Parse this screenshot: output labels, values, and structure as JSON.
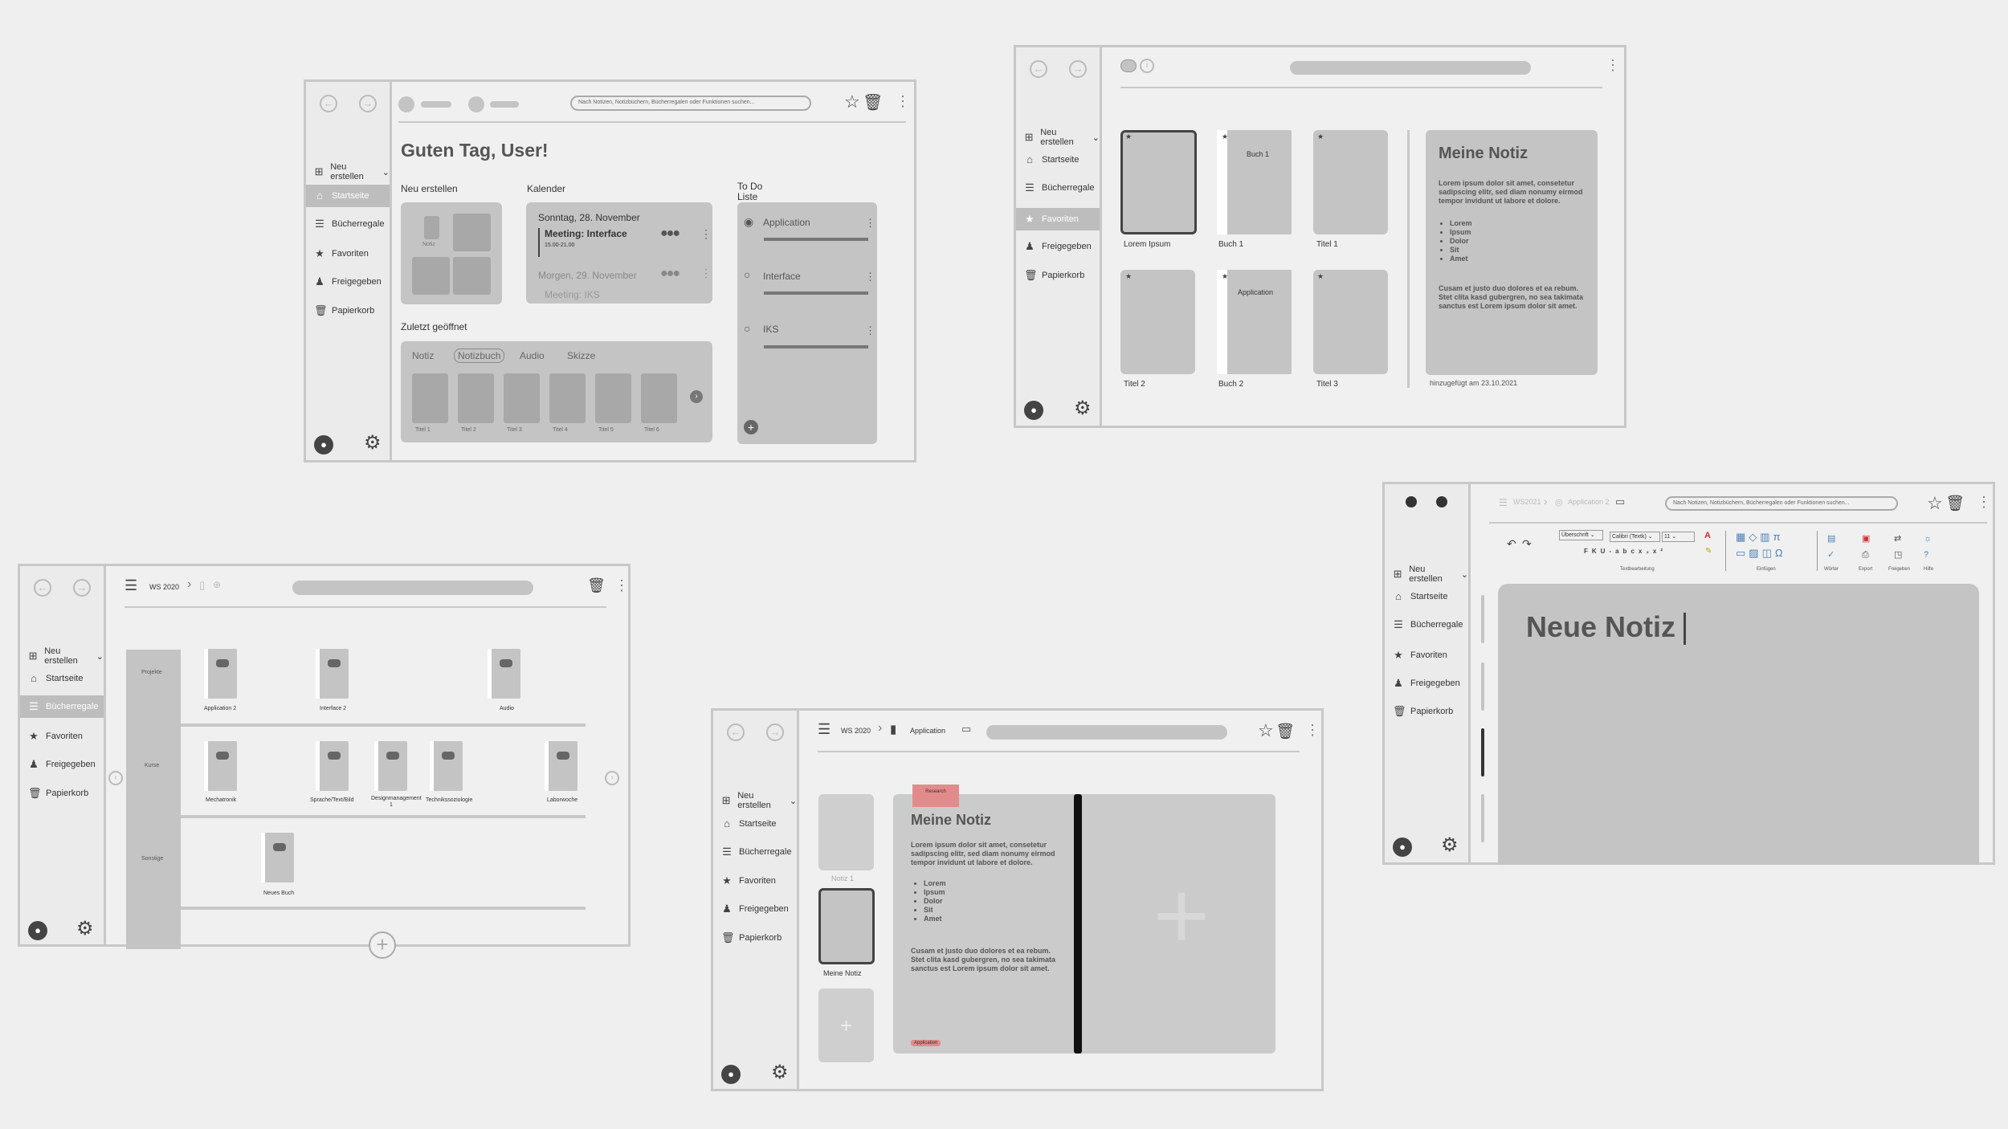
{
  "nav": {
    "neu": "Neu erstellen",
    "start": "Startseite",
    "buecher": "Bücherregale",
    "fav": "Favoriten",
    "frei": "Freigegeben",
    "papier": "Papierkorb"
  },
  "icons": {
    "back": "arrow-left-icon",
    "forward": "arrow-right-icon",
    "plus": "plus-square-icon",
    "home": "home-icon",
    "shelf": "bookshelf-icon",
    "star": "star-icon",
    "shared": "users-icon",
    "trash": "trash-icon",
    "user": "user-icon",
    "settings": "gear-icon"
  },
  "screen1": {
    "search_placeholder": "Nach Notizen, Notizbüchern, Bücherregalen oder Funktionen suchen...",
    "greeting": "Guten Tag, User!",
    "neu_title": "Neu erstellen",
    "notiz": "Notiz",
    "kalender": "Kalender",
    "cal_date1": "Sonntag, 28. November",
    "cal_event1": "Meeting: Interface",
    "cal_time1": "15.00-21.00",
    "cal_date2": "Morgen, 29. November",
    "cal_event2": "Meeting: IKS",
    "todo_title": "To Do",
    "todo_title2": "Liste",
    "todos": [
      "Application",
      "Interface",
      "IKS"
    ],
    "zuletzt": "Zuletzt geöffnet",
    "tabs": [
      "Notiz",
      "Notizbuch",
      "Audio",
      "Skizze"
    ],
    "titles": [
      "Titel 1",
      "Titel 2",
      "Titel 3",
      "Titel 4",
      "Titel 5",
      "Titel 6"
    ]
  },
  "screen2": {
    "cards": [
      "Lorem Ipsum",
      "Buch 1",
      "Titel 1",
      "Titel 2",
      "Buch 2",
      "Titel 3"
    ],
    "book1_label": "Buch 1",
    "book2_label": "Application",
    "preview_title": "Meine Notiz",
    "preview_p1": "Lorem ipsum dolor sit amet, consetetur sadipscing elitr, sed diam nonumy eirmod tempor invidunt ut labore et dolore.",
    "preview_list": [
      "Lorem",
      "Ipsum",
      "Dolor",
      "Sit",
      "Amet"
    ],
    "preview_p2": "Cusam et justo duo dolores et ea rebum. Stet clita kasd gubergren, no sea takimata sanctus est Lorem ipsum dolor sit amet.",
    "added": "hinzugefügt am 23.10.2021"
  },
  "screen3": {
    "crumb": "WS 2020",
    "rows": [
      "Projekte",
      "Kurse",
      "Sonstige"
    ],
    "books_r1": [
      "Application 2",
      "Interface 2",
      "Audio"
    ],
    "books_r2": [
      "Mechatronik",
      "Sprache/Text/Bild",
      "Designmanagement 1",
      "Technikssoziologie",
      "Laborwoche"
    ],
    "books_r3": [
      "Neues Buch"
    ]
  },
  "screen4": {
    "crumb1": "WS 2020",
    "crumb2": "Application",
    "thumbs": [
      "Notiz 1",
      "Meine Notiz"
    ],
    "tag_top": "Research",
    "note_title": "Meine Notiz",
    "note_p1": "Lorem ipsum dolor sit amet, consetetur sadipscing elitr, sed diam nonumy eirmod tempor invidunt ut labore et dolore.",
    "note_list": [
      "Lorem",
      "Ipsum",
      "Dolor",
      "Sit",
      "Amet"
    ],
    "note_p2": "Cusam et justo duo dolores et ea rebum. Stet clita kasd gubergren, no sea takimata sanctus est Lorem ipsum dolor sit amet.",
    "tag_bottom": "Application"
  },
  "screen5": {
    "crumb1": "WS2021",
    "crumb2": "Application 2",
    "search_placeholder": "Nach Notizen, Notizbüchern, Bücherregalen oder Funktionen suchen...",
    "style": "Überschrift",
    "font": "Calibri (Textk)",
    "size": "11",
    "groups": [
      "Textbearbeitung",
      "Einfügen",
      "Wörter",
      "Export",
      "Freigeben",
      "Hilfe"
    ],
    "title": "Neue Notiz"
  }
}
